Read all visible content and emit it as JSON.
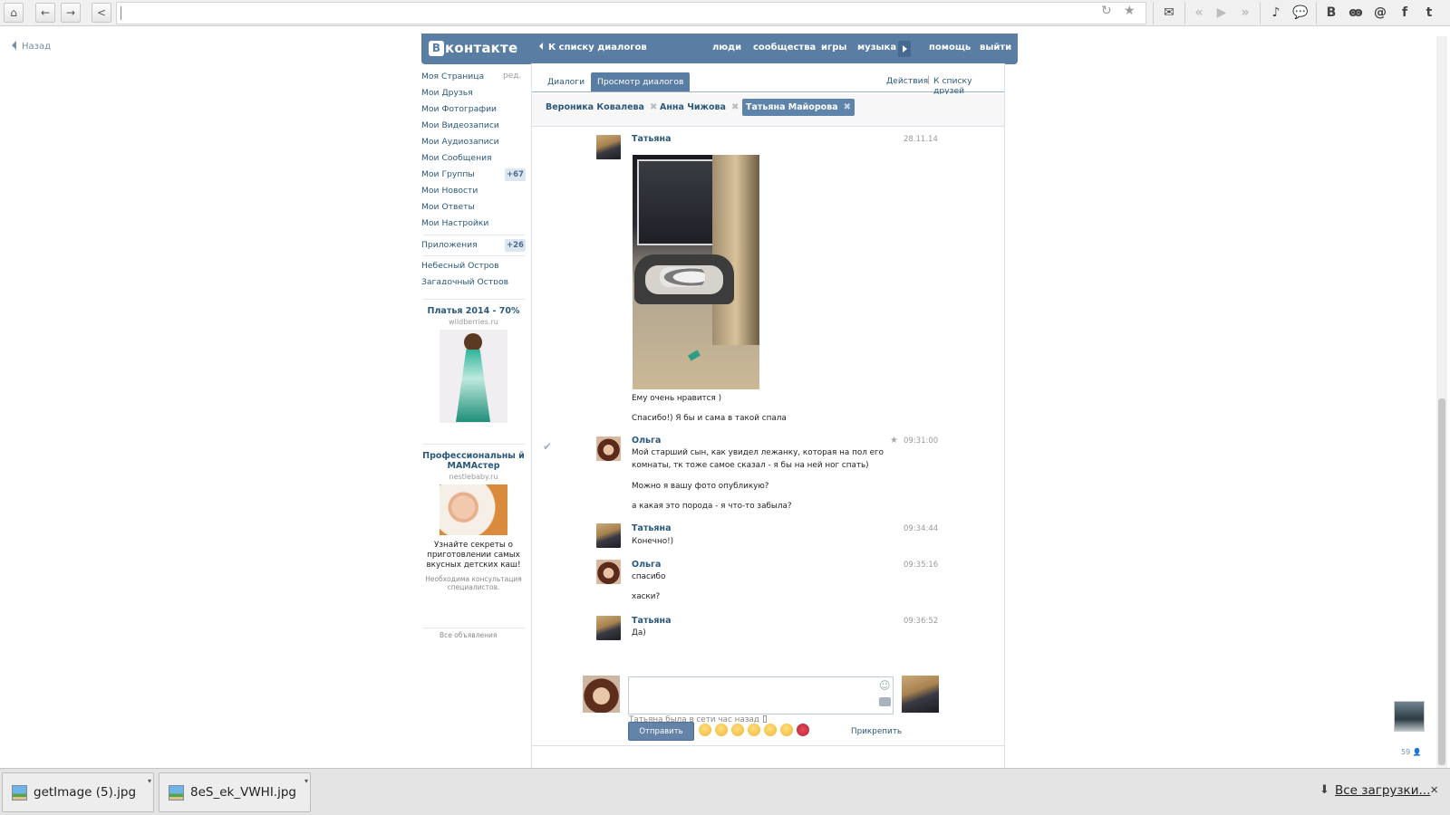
{
  "browser": {
    "address_value": "",
    "icons": [
      "home-icon",
      "back-icon",
      "forward-icon",
      "share-icon",
      "reload-icon",
      "bookmark-star-icon",
      "mail-icon",
      "media-prev-icon",
      "media-play-icon",
      "media-next-icon",
      "music-note-icon",
      "chat-bubbles-icon",
      "vk-icon",
      "odnoklassniki-icon",
      "moi-mir-icon",
      "facebook-icon",
      "twitter-icon"
    ]
  },
  "back_link": "Назад",
  "header": {
    "logo": "контакте",
    "logo_letter": "В",
    "back_to_dialogs": "К списку диалогов",
    "nav": [
      "люди",
      "сообщества",
      "игры",
      "музыка",
      "помощь",
      "выйти"
    ]
  },
  "left_menu": {
    "items": [
      "Моя Страница",
      "Мои Друзья",
      "Мои Фотографии",
      "Мои Видеозаписи",
      "Мои Аудиозаписи",
      "Мои Сообщения",
      "Мои Группы",
      "Мои Новости",
      "Мои Ответы",
      "Мои Настройки"
    ],
    "edit_label": "ред.",
    "groups_badge": "+67",
    "apps_label": "Приложения",
    "apps_badge": "+26",
    "apps": [
      "Небесный Остров",
      "Загадочный Остров"
    ]
  },
  "ads": [
    {
      "title": "Платья 2014 - 70%",
      "domain": "wildberries.ru"
    },
    {
      "title": "Профессиональны й МАМАстер",
      "domain": "nestlebaby.ru",
      "desc": "Узнайте секреты о приготовлении самых вкусных детских каш!",
      "note": "Необходима консультация специалистов."
    }
  ],
  "ads_all": "Все объявления",
  "tabs": {
    "dialogs": "Диалоги",
    "view_dialogs": "Просмотр диалогов",
    "actions": "Действия",
    "friends_list": "К списку друзей"
  },
  "chips": [
    {
      "name": "Вероника Ковалева"
    },
    {
      "name": "Анна Чижова"
    },
    {
      "name": "Татьяна Майорова"
    }
  ],
  "messages": [
    {
      "sender": "Татьяна",
      "time": "28.11.14",
      "lines": [
        "Ему очень нравится )",
        "Спасибо!) Я бы и сама в такой спала"
      ]
    },
    {
      "sender": "Ольга",
      "time": "09:31:00",
      "lines": [
        "Мой старший сын, как увидел лежанку, которая на пол его комнаты, тк тоже самое сказал - я бы на ней ног спать)",
        "Можно я вашу фото опубликую?",
        "а какая это порода - я что-то забыла?"
      ]
    },
    {
      "sender": "Татьяна",
      "time": "09:34:44",
      "lines": [
        "Конечно!)"
      ]
    },
    {
      "sender": "Ольга",
      "time": "09:35:16",
      "lines": [
        "спасибо",
        "хаски?"
      ]
    },
    {
      "sender": "Татьяна",
      "time": "09:36:52",
      "lines": [
        "Да)"
      ]
    }
  ],
  "online_status": "Татьяна была в сети час назад",
  "composer": {
    "send_label": "Отправить",
    "attach_label": "Прикрепить",
    "emojis": [
      "😁",
      "😳",
      "😮",
      "😑",
      "😐",
      "😏",
      "🌹"
    ]
  },
  "right_count": "59",
  "downloads": {
    "files": [
      "getImage (5).jpg",
      "8eS_ek_VWHI.jpg"
    ],
    "all_label": "Все загрузки..."
  }
}
